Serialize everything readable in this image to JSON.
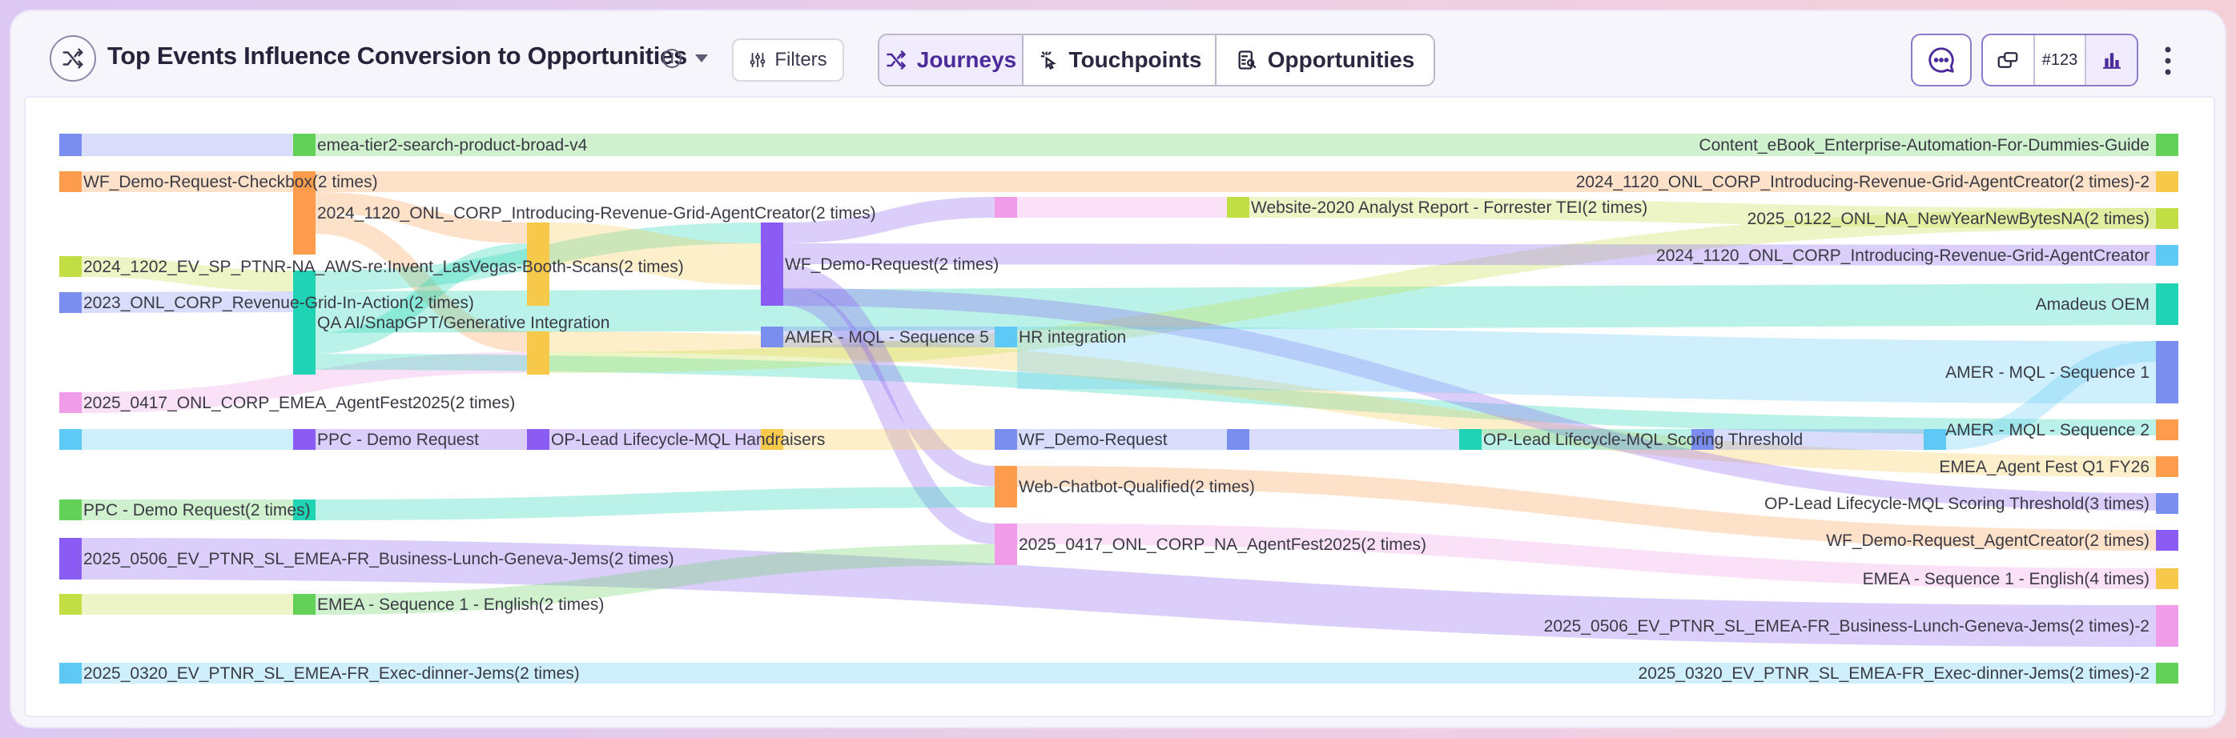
{
  "header": {
    "title": "Top Events Influence Conversion to Opportunities",
    "filters_label": "Filters",
    "tabs": [
      {
        "label": "Journeys",
        "icon": "shuffle-icon",
        "active": true
      },
      {
        "label": "Touchpoints",
        "icon": "tap-icon",
        "active": false
      },
      {
        "label": "Opportunities",
        "icon": "opportunity-icon",
        "active": false
      }
    ],
    "count_label": "#123"
  },
  "colors": {
    "blue": "#7a8ef0",
    "green": "#63d058",
    "orange": "#fc9c4c",
    "yellowgreen": "#c2de45",
    "pink": "#f09ce8",
    "cyan": "#5fc9f5",
    "purple": "#8a5cf2",
    "teal": "#1fd3b4",
    "yellow": "#f7c94b",
    "accent": "#4b2a9c"
  },
  "nodes": [
    {
      "id": "a1",
      "color": "blue",
      "label": ""
    },
    {
      "id": "a2",
      "color": "orange",
      "label": "WF_Demo-Request-Checkbox(2 times)"
    },
    {
      "id": "a3",
      "color": "yellowgreen",
      "label": "2024_1202_EV_SP_PTNR-NA_AWS-re:Invent_LasVegas-Booth-Scans(2 times)"
    },
    {
      "id": "a4",
      "color": "blue",
      "label": "2023_ONL_CORP_Revenue-Grid-In-Action(2 times)"
    },
    {
      "id": "a5",
      "color": "pink",
      "label": "2025_0417_ONL_CORP_EMEA_AgentFest2025(2 times)"
    },
    {
      "id": "a6",
      "color": "cyan",
      "label": ""
    },
    {
      "id": "a7",
      "color": "green",
      "label": "PPC - Demo Request(2 times)"
    },
    {
      "id": "a8",
      "color": "purple",
      "label": "2025_0506_EV_PTNR_SL_EMEA-FR_Business-Lunch-Geneva-Jems(2 times)"
    },
    {
      "id": "a9",
      "color": "yellowgreen",
      "label": ""
    },
    {
      "id": "a10",
      "color": "cyan",
      "label": "2025_0320_EV_PTNR_SL_EMEA-FR_Exec-dinner-Jems(2 times)"
    },
    {
      "id": "b1",
      "color": "green",
      "label": "emea-tier2-search-product-broad-v4"
    },
    {
      "id": "b2",
      "color": "orange",
      "label": "2024_1120_ONL_CORP_Introducing-Revenue-Grid-AgentCreator(2 times)"
    },
    {
      "id": "b3",
      "color": "teal",
      "label": "QA AI/SnapGPT/Generative Integration"
    },
    {
      "id": "b4",
      "color": "purple",
      "label": "PPC - Demo Request"
    },
    {
      "id": "b5",
      "color": "teal",
      "label": ""
    },
    {
      "id": "b6",
      "color": "green",
      "label": "EMEA - Sequence 1 - English(2 times)"
    },
    {
      "id": "c1",
      "color": "yellow",
      "label": ""
    },
    {
      "id": "c2",
      "color": "yellow",
      "label": ""
    },
    {
      "id": "c3",
      "color": "purple",
      "label": "OP-Lead Lifecycle-MQL Handraisers"
    },
    {
      "id": "d1",
      "color": "purple",
      "label": "WF_Demo-Request(2 times)"
    },
    {
      "id": "d2",
      "color": "blue",
      "label": "AMER - MQL - Sequence 5"
    },
    {
      "id": "d3",
      "color": "yellow",
      "label": ""
    },
    {
      "id": "e1",
      "color": "pink",
      "label": ""
    },
    {
      "id": "e2",
      "color": "cyan",
      "label": "HR integration"
    },
    {
      "id": "e3",
      "color": "blue",
      "label": "WF_Demo-Request"
    },
    {
      "id": "e4",
      "color": "orange",
      "label": "Web-Chatbot-Qualified(2 times)"
    },
    {
      "id": "e5",
      "color": "pink",
      "label": "2025_0417_ONL_CORP_NA_AgentFest2025(2 times)"
    },
    {
      "id": "f1",
      "color": "yellowgreen",
      "label": "Website-2020 Analyst Report - Forrester TEI(2 times)"
    },
    {
      "id": "f2",
      "color": "blue",
      "label": ""
    },
    {
      "id": "g1",
      "color": "teal",
      "label": "OP-Lead Lifecycle-MQL Scoring Threshold"
    },
    {
      "id": "h1",
      "color": "blue",
      "label": ""
    },
    {
      "id": "i1",
      "color": "cyan",
      "label": ""
    },
    {
      "id": "z1",
      "color": "green",
      "label": "Content_eBook_Enterprise-Automation-For-Dummies-Guide"
    },
    {
      "id": "z2",
      "color": "yellow",
      "label": "2024_1120_ONL_CORP_Introducing-Revenue-Grid-AgentCreator(2 times)-2"
    },
    {
      "id": "z3",
      "color": "yellowgreen",
      "label": "2025_0122_ONL_NA_NewYearNewBytesNA(2 times)"
    },
    {
      "id": "z4",
      "color": "cyan",
      "label": "2024_1120_ONL_CORP_Introducing-Revenue-Grid-AgentCreator"
    },
    {
      "id": "z5",
      "color": "teal",
      "label": "Amadeus OEM"
    },
    {
      "id": "z6",
      "color": "blue",
      "label": "AMER - MQL - Sequence 1"
    },
    {
      "id": "z7",
      "color": "orange",
      "label": "AMER - MQL - Sequence 2"
    },
    {
      "id": "z8",
      "color": "orange",
      "label": "EMEA_Agent Fest Q1 FY26"
    },
    {
      "id": "z9",
      "color": "blue",
      "label": "OP-Lead Lifecycle-MQL Scoring Threshold(3 times)"
    },
    {
      "id": "z10",
      "color": "purple",
      "label": "WF_Demo-Request_AgentCreator(2 times)"
    },
    {
      "id": "z11",
      "color": "yellow",
      "label": "EMEA - Sequence 1 - English(4 times)"
    },
    {
      "id": "z12",
      "color": "pink",
      "label": "2025_0506_EV_PTNR_SL_EMEA-FR_Business-Lunch-Geneva-Jems(2 times)-2"
    },
    {
      "id": "z13",
      "color": "green",
      "label": "2025_0320_EV_PTNR_SL_EMEA-FR_Exec-dinner-Jems(2 times)-2"
    }
  ],
  "flows": [
    {
      "from": "a1",
      "to": "b1",
      "color": "blue"
    },
    {
      "from": "b1",
      "to": "z1",
      "color": "green"
    },
    {
      "from": "a2",
      "to": "b2",
      "color": "orange"
    },
    {
      "from": "b2",
      "to": "z2",
      "color": "orange"
    },
    {
      "from": "b2",
      "to": "c1",
      "color": "orange"
    },
    {
      "from": "b2",
      "to": "c2",
      "color": "orange"
    },
    {
      "from": "a3",
      "to": "b3",
      "color": "yellowgreen"
    },
    {
      "from": "a4",
      "to": "b3",
      "color": "blue"
    },
    {
      "from": "a5",
      "to": "c2",
      "color": "pink"
    },
    {
      "from": "b3",
      "to": "d1",
      "color": "teal"
    },
    {
      "from": "b3",
      "to": "z5",
      "color": "teal"
    },
    {
      "from": "b3",
      "to": "c1",
      "color": "teal"
    },
    {
      "from": "b3",
      "to": "z7",
      "color": "teal"
    },
    {
      "from": "c1",
      "to": "d1",
      "color": "yellow"
    },
    {
      "from": "c2",
      "to": "z8",
      "color": "yellow"
    },
    {
      "from": "c2",
      "to": "z3",
      "color": "yellowgreen"
    },
    {
      "from": "d1",
      "to": "e1",
      "color": "purple"
    },
    {
      "from": "d1",
      "to": "z4",
      "color": "purple"
    },
    {
      "from": "d1",
      "to": "e4",
      "color": "purple"
    },
    {
      "from": "d1",
      "to": "e5",
      "color": "purple"
    },
    {
      "from": "d1",
      "to": "z9",
      "color": "purple"
    },
    {
      "from": "d2",
      "to": "e2",
      "color": "blue"
    },
    {
      "from": "e2",
      "to": "z6",
      "color": "cyan"
    },
    {
      "from": "e1",
      "to": "f1",
      "color": "pink"
    },
    {
      "from": "f1",
      "to": "z3",
      "color": "yellowgreen"
    },
    {
      "from": "a6",
      "to": "b4",
      "color": "cyan"
    },
    {
      "from": "b4",
      "to": "c3",
      "color": "purple"
    },
    {
      "from": "c3",
      "to": "d3",
      "color": "purple"
    },
    {
      "from": "d3",
      "to": "e3",
      "color": "yellow"
    },
    {
      "from": "e3",
      "to": "f2",
      "color": "blue"
    },
    {
      "from": "f2",
      "to": "g1",
      "color": "blue"
    },
    {
      "from": "g1",
      "to": "h1",
      "color": "teal"
    },
    {
      "from": "h1",
      "to": "i1",
      "color": "blue"
    },
    {
      "from": "i1",
      "to": "z6",
      "color": "cyan"
    },
    {
      "from": "a7",
      "to": "b5",
      "color": "green"
    },
    {
      "from": "b5",
      "to": "e4",
      "color": "teal"
    },
    {
      "from": "e4",
      "to": "z10",
      "color": "orange"
    },
    {
      "from": "a8",
      "to": "z12",
      "color": "purple"
    },
    {
      "from": "a9",
      "to": "b6",
      "color": "yellowgreen"
    },
    {
      "from": "b6",
      "to": "e5",
      "color": "green"
    },
    {
      "from": "e5",
      "to": "z11",
      "color": "pink"
    },
    {
      "from": "a10",
      "to": "z13",
      "color": "cyan"
    }
  ]
}
